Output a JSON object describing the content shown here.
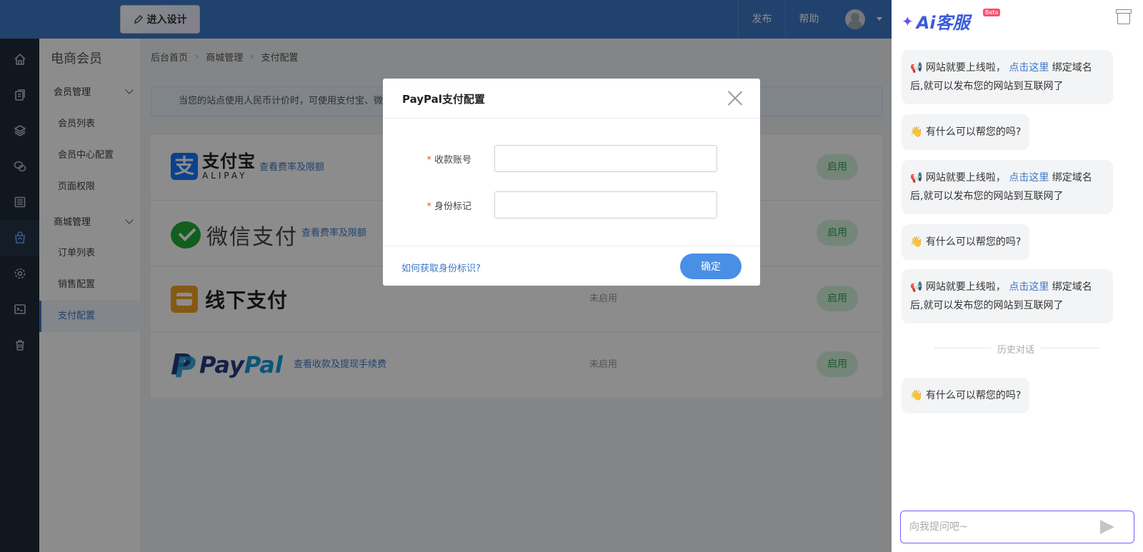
{
  "header": {
    "design_button": "进入设计",
    "publish": "发布",
    "help": "帮助"
  },
  "subnav": {
    "title": "电商会员",
    "group1": "会员管理",
    "group1_items": [
      "会员列表",
      "会员中心配置",
      "页面权限"
    ],
    "group2": "商城管理",
    "group2_items": [
      "订单列表",
      "销售配置",
      "支付配置"
    ]
  },
  "breadcrumb": [
    "后台首页",
    "商城管理",
    "支付配置"
  ],
  "notice": "当您的站点使用人民币计价时，可使用支付宝、微",
  "payments": {
    "alipay": {
      "name_cn": "支付宝",
      "name_en": "ALIPAY",
      "link": "查看费率及限额",
      "button": "启用"
    },
    "wechat": {
      "name": "微信支付",
      "link": "查看费率及限额",
      "button": "启用"
    },
    "offline": {
      "name": "线下支付",
      "status": "未启用",
      "button": "启用"
    },
    "paypal": {
      "name_a": "Pay",
      "name_b": "Pal",
      "link": "查看收款及提现手续费",
      "status": "未启用",
      "button": "启用"
    }
  },
  "modal": {
    "title": "PayPal支付配置",
    "field1_label": "收款账号",
    "field2_label": "身份标记",
    "field1_value": "",
    "field2_value": "",
    "help_link": "如何获取身份标识?",
    "confirm": "确定"
  },
  "chat": {
    "logo_text": "Ai客服",
    "beta": "Beta",
    "msg_launch_pre": "网站就要上线啦，",
    "msg_launch_link": "点击这里",
    "msg_launch_post": "绑定域名后,就可以发布您的网站到互联网了",
    "msg_help": "有什么可以帮您的吗?",
    "history": "历史对话",
    "input_placeholder": "向我提问吧~"
  },
  "colors": {
    "topbar": "#3d78c7",
    "rail": "#1f2a3a",
    "accent": "#4a8fe6",
    "enable_bg": "#d5f3df",
    "enable_text": "#2fa759"
  }
}
